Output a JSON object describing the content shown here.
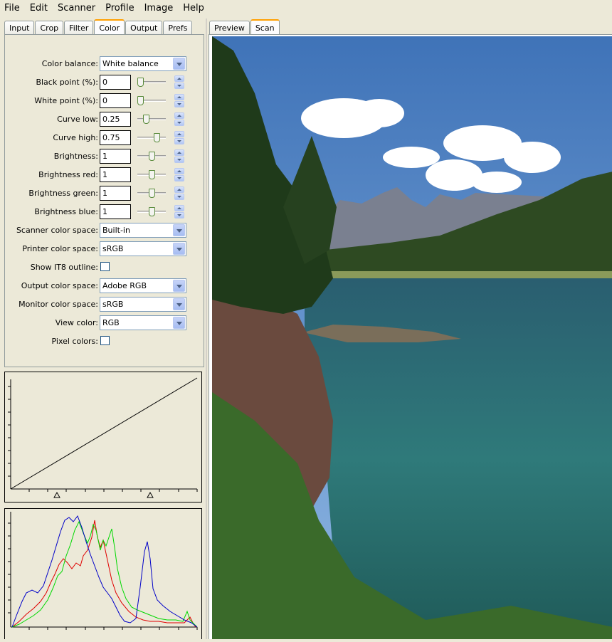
{
  "menu": [
    "File",
    "Edit",
    "Scanner",
    "Profile",
    "Image",
    "Help"
  ],
  "left_tabs": [
    "Input",
    "Crop",
    "Filter",
    "Color",
    "Output",
    "Prefs"
  ],
  "left_active_tab": "Color",
  "right_tabs": [
    "Preview",
    "Scan"
  ],
  "right_active_tab": "Scan",
  "color": {
    "color_balance": {
      "label": "Color balance:",
      "value": "White balance"
    },
    "black_point": {
      "label": "Black point (%):",
      "value": "0",
      "slider": 0.0
    },
    "white_point": {
      "label": "White point (%):",
      "value": "0",
      "slider": 0.0
    },
    "curve_low": {
      "label": "Curve low:",
      "value": "0.25",
      "slider": 0.25
    },
    "curve_high": {
      "label": "Curve high:",
      "value": "0.75",
      "slider": 0.75
    },
    "brightness": {
      "label": "Brightness:",
      "value": "1",
      "slider": 0.5
    },
    "brightness_red": {
      "label": "Brightness red:",
      "value": "1",
      "slider": 0.5
    },
    "brightness_green": {
      "label": "Brightness green:",
      "value": "1",
      "slider": 0.5
    },
    "brightness_blue": {
      "label": "Brightness blue:",
      "value": "1",
      "slider": 0.5
    },
    "scanner_color_space": {
      "label": "Scanner color space:",
      "value": "Built-in"
    },
    "printer_color_space": {
      "label": "Printer color space:",
      "value": "sRGB"
    },
    "show_it8_outline": {
      "label": "Show IT8 outline:",
      "checked": false
    },
    "output_color_space": {
      "label": "Output color space:",
      "value": "Adobe RGB"
    },
    "monitor_color_space": {
      "label": "Monitor color space:",
      "value": "sRGB"
    },
    "view_color": {
      "label": "View color:",
      "value": "RGB"
    },
    "pixel_colors": {
      "label": "Pixel colors:",
      "checked": false
    }
  },
  "colors": {
    "red": "#e00000",
    "green": "#00d800",
    "blue": "#0000c8",
    "tab_accent": "#ff9f00"
  }
}
